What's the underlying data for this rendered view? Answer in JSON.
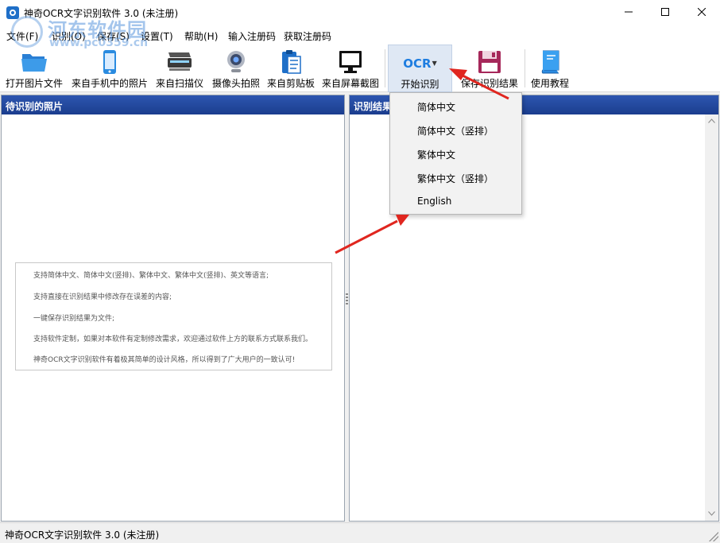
{
  "window": {
    "title": "神奇OCR文字识别软件 3.0 (未注册)"
  },
  "watermark": {
    "text": "河东软件园",
    "url": "www.pc0359.cn"
  },
  "menu": [
    {
      "label": "文件(F)"
    },
    {
      "label": "识别(O)"
    },
    {
      "label": "保存(S)"
    },
    {
      "label": "设置(T)"
    },
    {
      "label": "帮助(H)"
    },
    {
      "label": "输入注册码"
    },
    {
      "label": "获取注册码"
    }
  ],
  "toolbar": {
    "open_image": "打开图片文件",
    "from_phone": "来自手机中的照片",
    "from_scanner": "来自扫描仪",
    "camera": "摄像头拍照",
    "from_clipboard": "来自剪贴板",
    "from_screenshot": "来自屏幕截图",
    "ocr_logo": "OCR",
    "start_ocr": "开始识别",
    "save_result": "保存识别结果",
    "tutorial": "使用教程"
  },
  "left_panel": {
    "title": "待识别的照片",
    "info_lines": [
      "支持简体中文、简体中文(竖排)、繁体中文、繁体中文(竖排)、英文等语言;",
      "支持直接在识别结果中修改存在误差的内容;",
      "一键保存识别结果为文件;",
      "支持软件定制，如果对本软件有定制修改需求，欢迎通过软件上方的联系方式联系我们。",
      "神奇OCR文字识别软件有着极其简单的设计风格，所以得到了广大用户的一致认可!"
    ]
  },
  "right_panel": {
    "title": "识别结果"
  },
  "dropdown": {
    "items": [
      {
        "label": "简体中文"
      },
      {
        "label": "简体中文（竖排）"
      },
      {
        "label": "繁体中文"
      },
      {
        "label": "繁体中文（竖排）"
      },
      {
        "label": "English"
      }
    ]
  },
  "statusbar": {
    "text": "神奇OCR文字识别软件 3.0 (未注册)"
  },
  "colors": {
    "panel_header": "#1f4496",
    "accent_blue": "#1e7de0",
    "annotation_arrow": "#e0261f"
  }
}
